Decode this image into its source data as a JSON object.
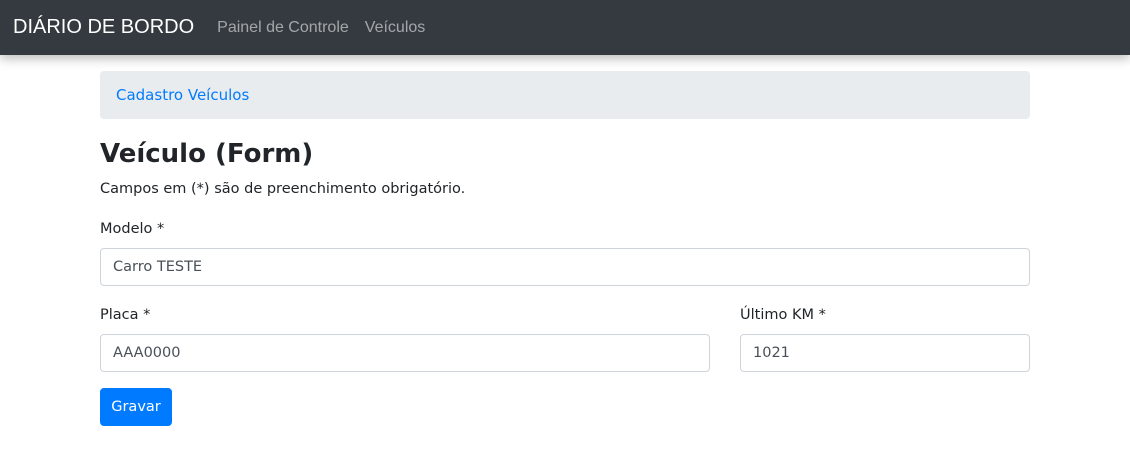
{
  "navbar": {
    "brand": "DIÁRIO DE BORDO",
    "links": [
      "Painel de Controle",
      "Veículos"
    ],
    "background": "#343a40"
  },
  "breadcrumb": {
    "item": "Cadastro Veículos"
  },
  "form": {
    "title": "Veículo (Form)",
    "hint": "Campos em (*) são de preenchimento obrigatório.",
    "modelo": {
      "label": "Modelo *",
      "value": "Carro TESTE"
    },
    "placa": {
      "label": "Placa *",
      "value": "AAA0000"
    },
    "ultimo_km": {
      "label": "Último KM *",
      "value": "1021"
    },
    "submit_label": "Gravar"
  },
  "colors": {
    "primary": "#007bff",
    "breadcrumb_bg": "#e9ecef"
  }
}
